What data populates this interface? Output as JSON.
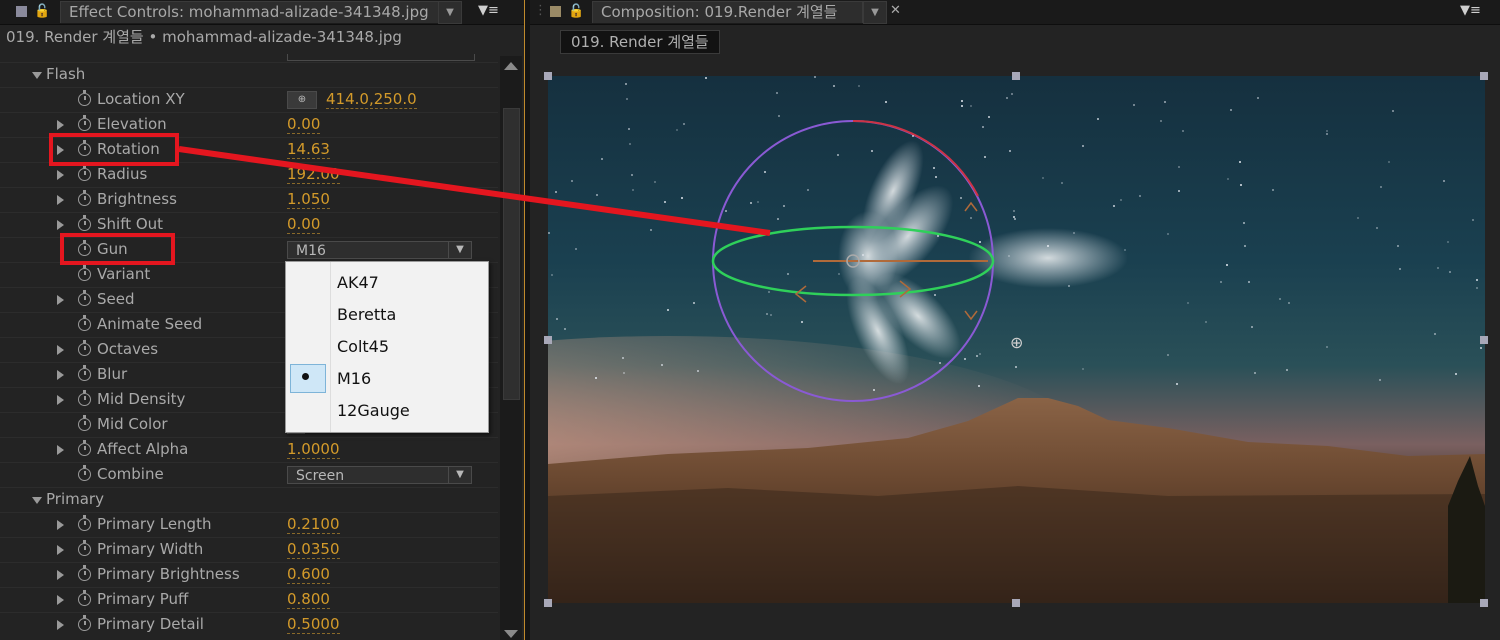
{
  "left_panel": {
    "tab_title": "Effect Controls: mohammad-alizade-341348.jpg",
    "subheader": "019. Render 계열들 • mohammad-alizade-341348.jpg"
  },
  "sections": {
    "flash": "Flash",
    "primary": "Primary"
  },
  "properties": [
    {
      "key": "location_xy",
      "label": "Location XY",
      "value": "414.0,250.0",
      "expandable": false
    },
    {
      "key": "elevation",
      "label": "Elevation",
      "value": "0.00",
      "expandable": true
    },
    {
      "key": "rotation",
      "label": "Rotation",
      "value": "14.63",
      "expandable": true
    },
    {
      "key": "radius",
      "label": "Radius",
      "value": "192.00",
      "expandable": true
    },
    {
      "key": "brightness",
      "label": "Brightness",
      "value": "1.050",
      "expandable": true
    },
    {
      "key": "shift_out",
      "label": "Shift Out",
      "value": "0.00",
      "expandable": true
    },
    {
      "key": "gun",
      "label": "Gun",
      "value": "M16",
      "expandable": false
    },
    {
      "key": "variant",
      "label": "Variant",
      "value": "",
      "expandable": false
    },
    {
      "key": "seed",
      "label": "Seed",
      "value": "",
      "expandable": true
    },
    {
      "key": "animate_seed",
      "label": "Animate Seed",
      "value": "",
      "expandable": false
    },
    {
      "key": "octaves",
      "label": "Octaves",
      "value": "",
      "expandable": true
    },
    {
      "key": "blur",
      "label": "Blur",
      "value": "",
      "expandable": true
    },
    {
      "key": "mid_density",
      "label": "Mid Density",
      "value": "",
      "expandable": true
    },
    {
      "key": "mid_color",
      "label": "Mid Color",
      "value": "",
      "expandable": false
    },
    {
      "key": "affect_alpha",
      "label": "Affect Alpha",
      "value": "1.0000",
      "expandable": true
    },
    {
      "key": "combine",
      "label": "Combine",
      "value": "Screen",
      "expandable": false
    }
  ],
  "primary_properties": [
    {
      "key": "primary_length",
      "label": "Primary Length",
      "value": "0.2100"
    },
    {
      "key": "primary_width",
      "label": "Primary Width",
      "value": "0.0350"
    },
    {
      "key": "primary_brightness",
      "label": "Primary Brightness",
      "value": "0.600"
    },
    {
      "key": "primary_puff",
      "label": "Primary Puff",
      "value": "0.800"
    },
    {
      "key": "primary_detail",
      "label": "Primary Detail",
      "value": "0.5000"
    }
  ],
  "gun_dropdown": {
    "options": [
      "AK47",
      "Beretta",
      "Colt45",
      "M16",
      "12Gauge"
    ],
    "selected": "M16"
  },
  "right_panel": {
    "tab_title": "Composition: 019.Render 계열들",
    "comp_label": "019. Render 계열들"
  },
  "icons": {
    "lock": "lock-icon",
    "panel_menu": "panel-menu-icon",
    "close": "close-icon",
    "stopwatch": "stopwatch-icon",
    "crosshair": "crosshair-icon"
  },
  "colors": {
    "accent_orange": "#d39a2a",
    "highlight_red": "#e4161f",
    "panel_bg": "#232323"
  }
}
